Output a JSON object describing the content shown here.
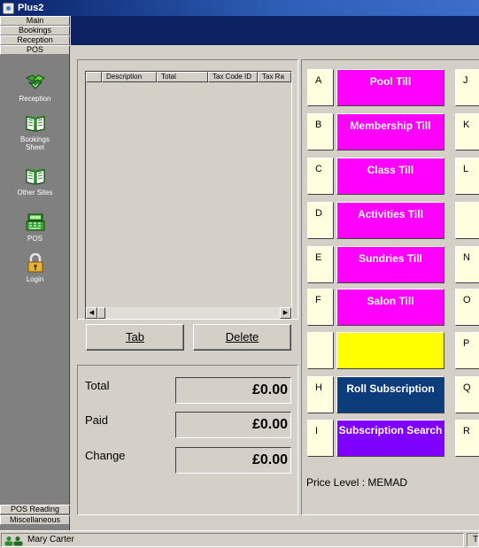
{
  "window": {
    "title": "Plus2"
  },
  "nav": {
    "top_tabs": [
      "Main",
      "Bookings",
      "Reception",
      "POS"
    ],
    "items": [
      {
        "label": "Reception",
        "icon": "handshake-icon"
      },
      {
        "label": "Bookings Sheet",
        "icon": "open-book-icon"
      },
      {
        "label": "Other Sites",
        "icon": "open-book-icon"
      },
      {
        "label": "POS",
        "icon": "till-icon"
      },
      {
        "label": "Login",
        "icon": "padlock-icon"
      }
    ],
    "bottom_tabs": [
      "POS Reading",
      "Miscellaneous"
    ]
  },
  "list": {
    "columns": [
      "Description",
      "Total",
      "Tax Code ID",
      "Tax Ra"
    ]
  },
  "buttons": {
    "tab": "Tab",
    "delete": "Delete"
  },
  "totals": {
    "total_label": "Total",
    "total_value": "£0.00",
    "paid_label": "Paid",
    "paid_value": "£0.00",
    "change_label": "Change",
    "change_value": "£0.00"
  },
  "tills": {
    "left_letters": [
      "A",
      "B",
      "C",
      "D",
      "E",
      "F",
      "",
      "H",
      "I"
    ],
    "right_letters": [
      "J",
      "K",
      "L",
      "",
      "N",
      "O",
      "P",
      "Q",
      "R"
    ],
    "buttons": [
      {
        "label": "Pool Till",
        "color": "#ff00ff"
      },
      {
        "label": "Membership Till",
        "color": "#ff00ff"
      },
      {
        "label": "Class Till",
        "color": "#ff00ff"
      },
      {
        "label": "Activities Till",
        "color": "#ff00ff"
      },
      {
        "label": "Sundries Till",
        "color": "#ff00ff"
      },
      {
        "label": "Salon Till",
        "color": "#ff00ff"
      },
      {
        "label": "",
        "color": "#ffff00"
      },
      {
        "label": "Roll Subscription",
        "color": "#0c3d7a"
      },
      {
        "label": "Subscription Search",
        "color": "#8000ff"
      }
    ],
    "price_level": "Price Level : MEMAD"
  },
  "status": {
    "user": "Mary Carter",
    "right_text": "T"
  }
}
